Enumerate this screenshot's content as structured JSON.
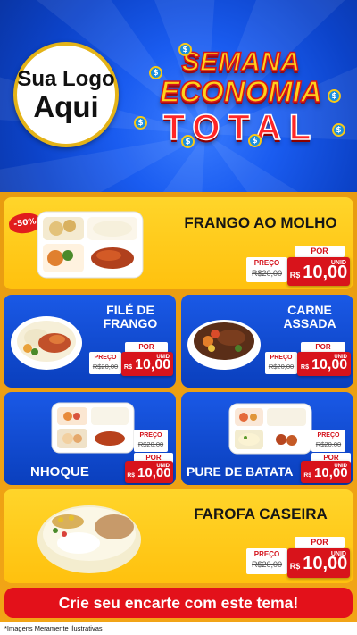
{
  "header": {
    "logo_line1": "Sua Logo",
    "logo_line2": "Aqui",
    "title_line1": "SEMANA",
    "title_line2": "ECONOMIA",
    "title_line3": "TOTAL",
    "coin_symbol": "$"
  },
  "products": [
    {
      "name_line1": "FRANGO AO MOLHO",
      "name_line2": "",
      "badge": "-50%",
      "por": "POR",
      "preco_label": "PREÇO",
      "old_price": "R$20,00",
      "currency": "R$",
      "price": "10,00",
      "unit": "UNID"
    },
    {
      "name_line1": "FILÉ DE",
      "name_line2": "FRANGO",
      "por": "POR",
      "preco_label": "PREÇO",
      "old_price": "R$20,00",
      "currency": "R$",
      "price": "10,00",
      "unit": "UNID"
    },
    {
      "name_line1": "CARNE",
      "name_line2": "ASSADA",
      "por": "POR",
      "preco_label": "PREÇO",
      "old_price": "R$20,00",
      "currency": "R$",
      "price": "10,00",
      "unit": "UNID"
    },
    {
      "name_line1": "NHOQUE",
      "name_line2": "",
      "por": "POR",
      "preco_label": "PREÇO",
      "old_price": "R$20,00",
      "currency": "R$",
      "price": "10,00",
      "unit": "UNID"
    },
    {
      "name_line1": "PURE DE BATATA",
      "name_line2": "",
      "por": "POR",
      "preco_label": "PREÇO",
      "old_price": "R$20,00",
      "currency": "R$",
      "price": "10,00",
      "unit": "UNID"
    },
    {
      "name_line1": "FAROFA CASEIRA",
      "name_line2": "",
      "por": "POR",
      "preco_label": "PREÇO",
      "old_price": "R$20,00",
      "currency": "R$",
      "price": "10,00",
      "unit": "UNID"
    }
  ],
  "cta": "Crie seu encarte com este tema!",
  "footnote": "*Imagens Meramente Ilustrativas",
  "colors": {
    "blue": "#0c43c9",
    "yellow": "#ffc10e",
    "red": "#d8131b",
    "orange": "#f2a516"
  }
}
